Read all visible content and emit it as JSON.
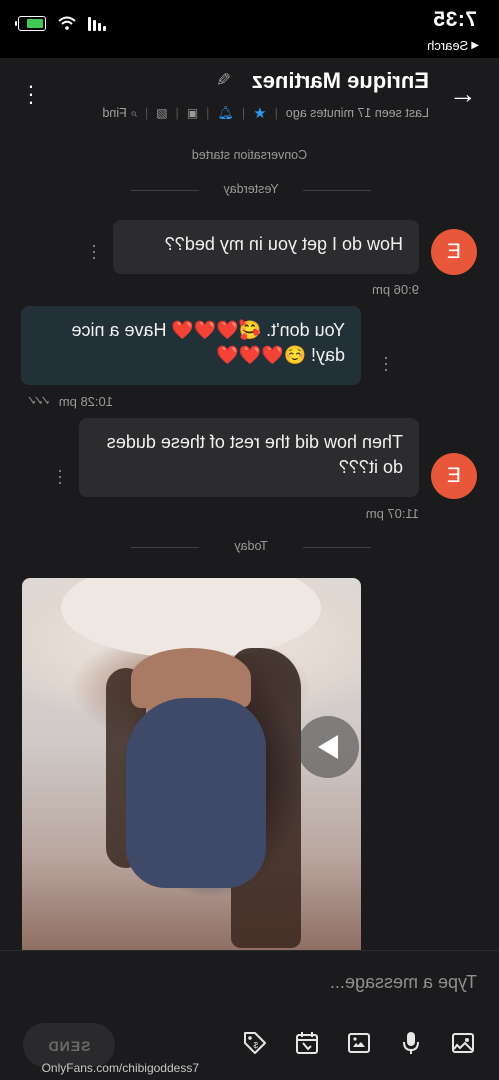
{
  "status_bar": {
    "time": "7:35",
    "back_label": "Search"
  },
  "header": {
    "contact_name": "Enrique Martinez",
    "last_seen": "Last seen 17 minutes ago",
    "find_label": "Find"
  },
  "chat": {
    "conversation_started": "Conversation started",
    "dividers": [
      "Yesterday",
      "Today"
    ],
    "messages": [
      {
        "direction": "incoming",
        "avatar_letter": "E",
        "text": "How do I get you in my bed??",
        "time": "9:06 pm"
      },
      {
        "direction": "outgoing",
        "text": "You don't. 🥰❤️❤️❤️ Have a nice day! ☺️❤️❤️❤️",
        "time": "10:28 pm"
      },
      {
        "direction": "incoming",
        "avatar_letter": "E",
        "text": "Then how did the rest of these dudes do it???",
        "time": "11:07 pm"
      }
    ]
  },
  "composer": {
    "placeholder": "Type a message...",
    "send_label": "SEND"
  },
  "watermark": "OnlyFans.com/chibigoddess7",
  "colors": {
    "accent": "#2d9bf0",
    "avatar": "#e8573a",
    "outgoing_bubble": "#223038",
    "incoming_bubble": "#2c2c2f"
  }
}
